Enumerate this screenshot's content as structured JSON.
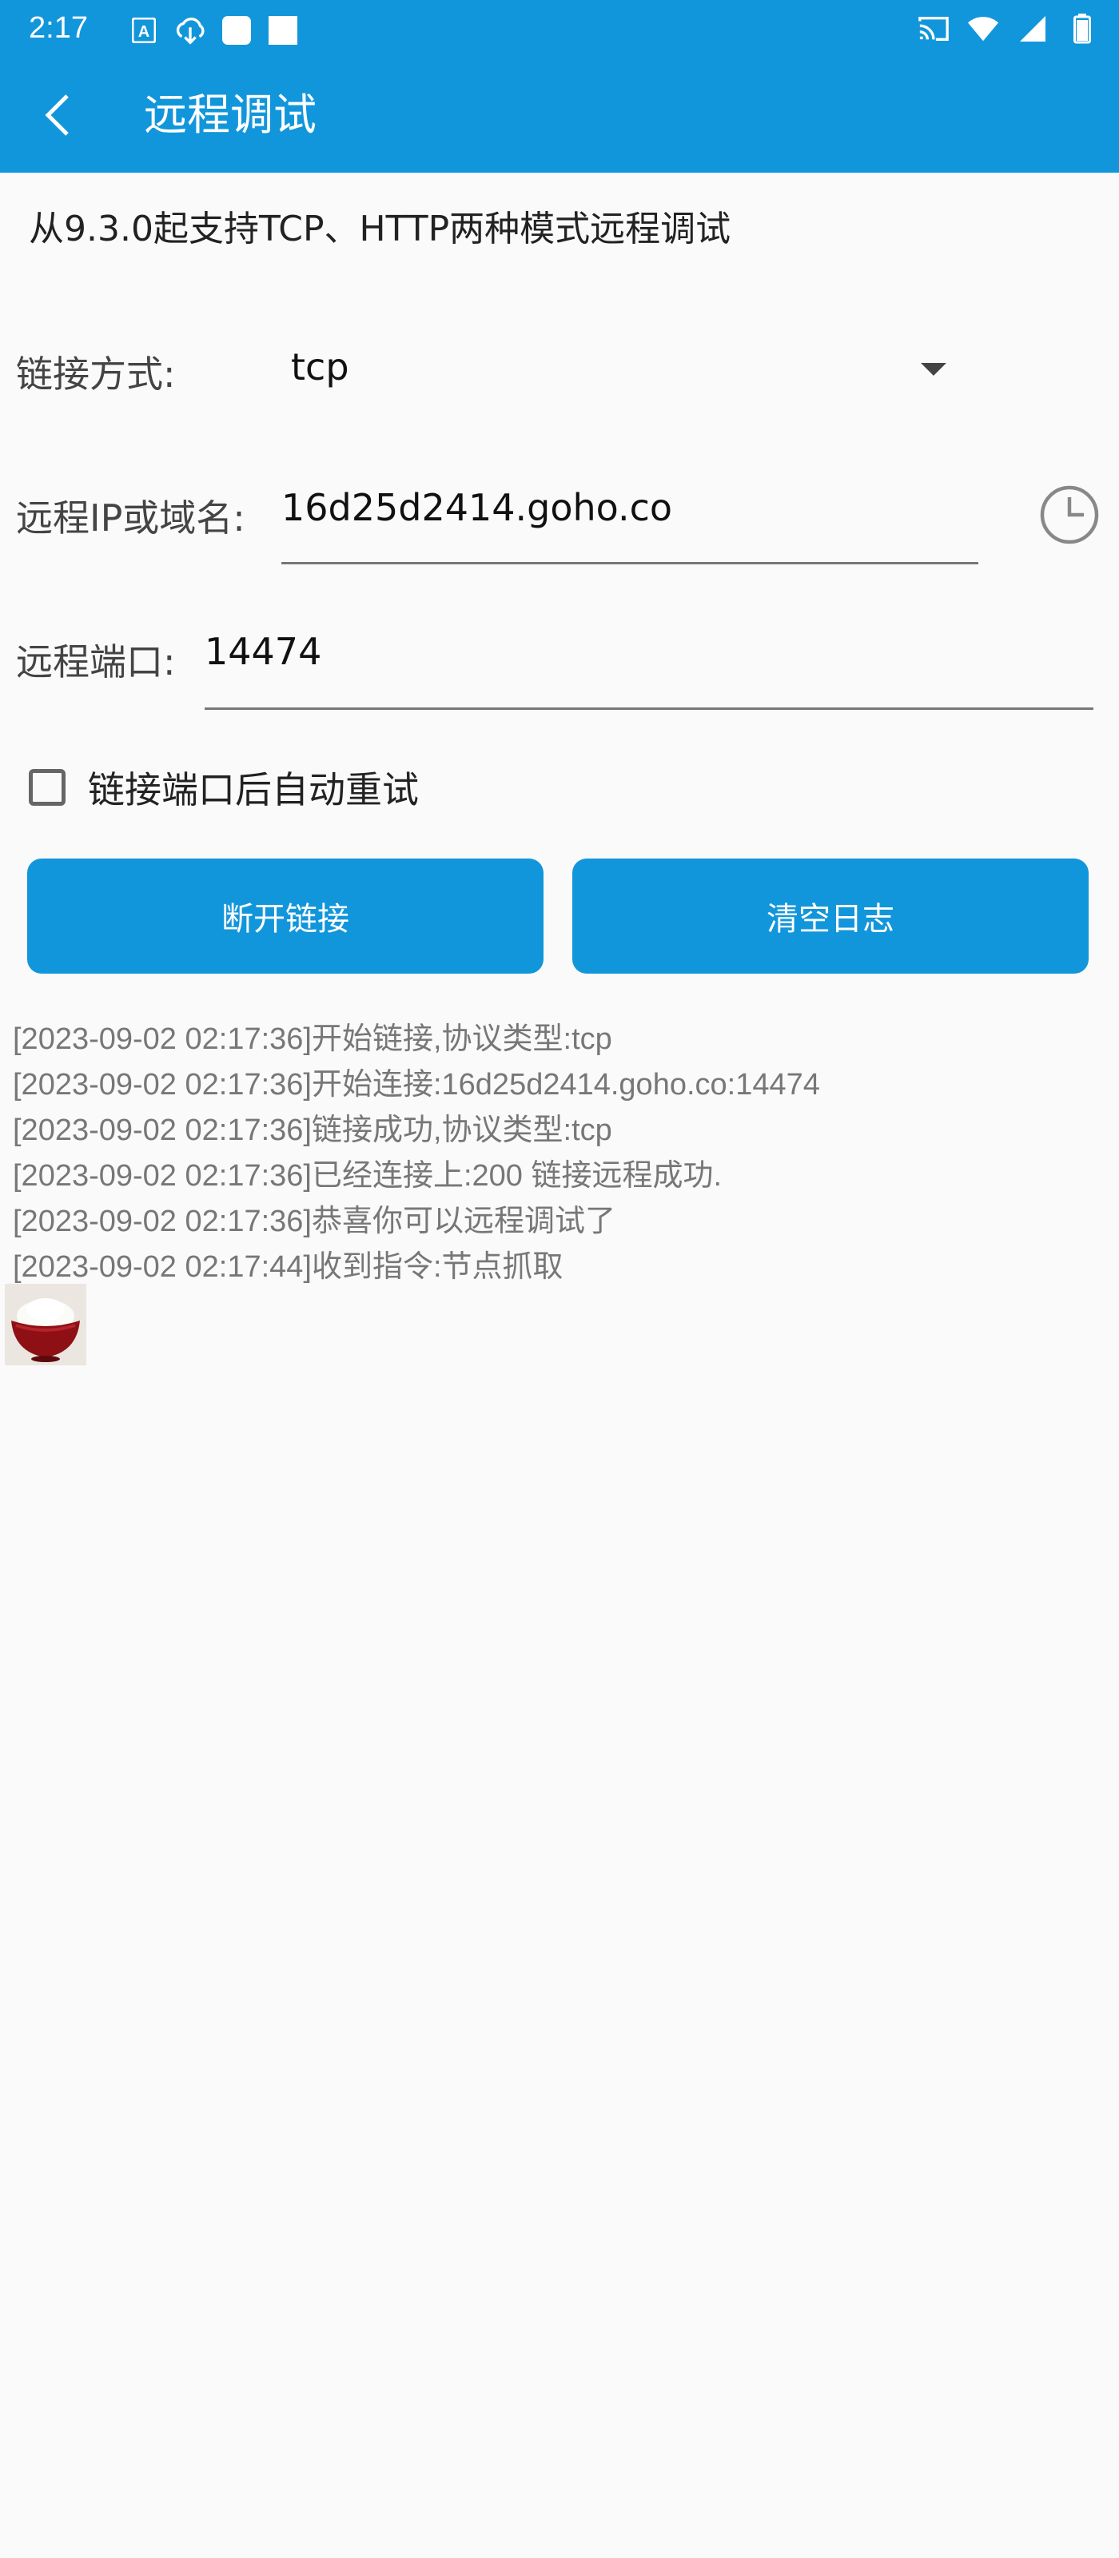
{
  "status_bar": {
    "time": "2:17",
    "background": "#1296db",
    "left_icons": [
      "translate-icon",
      "download-icon",
      "notification-square-icon",
      "notification-square-icon"
    ],
    "right_icons": [
      "cast-icon",
      "wifi-icon",
      "signal-icon",
      "battery-icon"
    ]
  },
  "app_bar": {
    "title": "远程调试",
    "back_icon": "back-arrow-icon"
  },
  "notice": "从9.3.0起支持TCP、HTTP两种模式远程调试",
  "form": {
    "mode_label": "链接方式:",
    "mode_value": "tcp",
    "ip_label": "远程IP或域名:",
    "ip_value": "16d25d2414.goho.co",
    "history_icon": "clock-icon",
    "port_label": "远程端口:",
    "port_value": "14474",
    "auto_retry_label": "链接端口后自动重试",
    "auto_retry_checked": false
  },
  "buttons": {
    "disconnect": "断开链接",
    "clear_log": "清空日志",
    "color": "#1296db"
  },
  "log": [
    "[2023-09-02 02:17:36]开始链接,协议类型:tcp",
    "[2023-09-02 02:17:36]开始连接:16d25d2414.goho.co:14474",
    "[2023-09-02 02:17:36]链接成功,协议类型:tcp",
    "[2023-09-02 02:17:36]已经连接上:200 链接远程成功.",
    "[2023-09-02 02:17:36]恭喜你可以远程调试了",
    "[2023-09-02 02:17:44]收到指令:节点抓取"
  ],
  "thumbnail": "rice-bowl-image"
}
